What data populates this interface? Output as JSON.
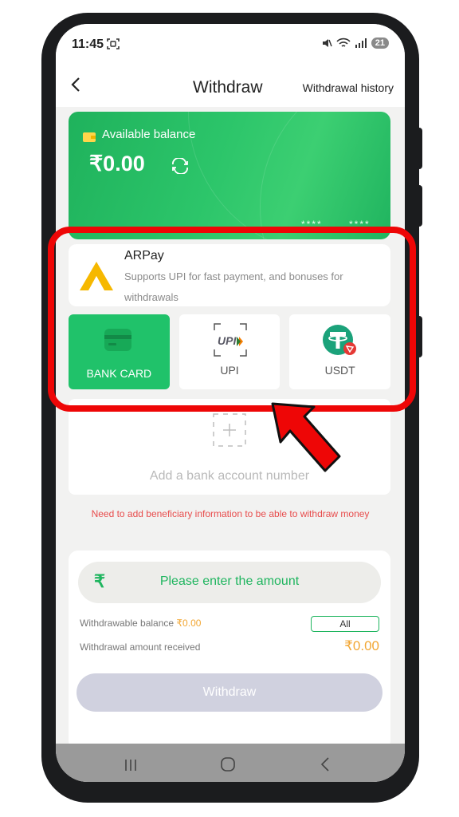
{
  "status_bar": {
    "time": "11:45",
    "battery": "21"
  },
  "header": {
    "title": "Withdraw",
    "history_link": "Withdrawal history"
  },
  "balance_card": {
    "label": "Available balance",
    "amount": "₹0.00",
    "masked_1": "****",
    "masked_2": "****",
    "color": "#2cc56a"
  },
  "arpay": {
    "name": "ARPay",
    "description": "Supports UPI for fast payment, and bonuses for withdrawals"
  },
  "methods": [
    {
      "label": "BANK CARD",
      "active": true
    },
    {
      "label": "UPI",
      "active": false
    },
    {
      "label": "USDT",
      "active": false
    }
  ],
  "add_account": {
    "text": "Add a bank account number"
  },
  "warning": "Need to add beneficiary information to be able to withdraw money",
  "amount_section": {
    "currency_symbol": "₹",
    "placeholder": "Please enter the amount",
    "withdrawable_label": "Withdrawable balance",
    "withdrawable_value": "₹0.00",
    "all_button": "All",
    "received_label": "Withdrawal amount received",
    "received_value": "₹0.00",
    "submit_label": "Withdraw"
  },
  "colors": {
    "accent": "#1fb55f",
    "warning": "#e84c4c",
    "highlight": "#ee0606",
    "orange": "#f2a632"
  }
}
